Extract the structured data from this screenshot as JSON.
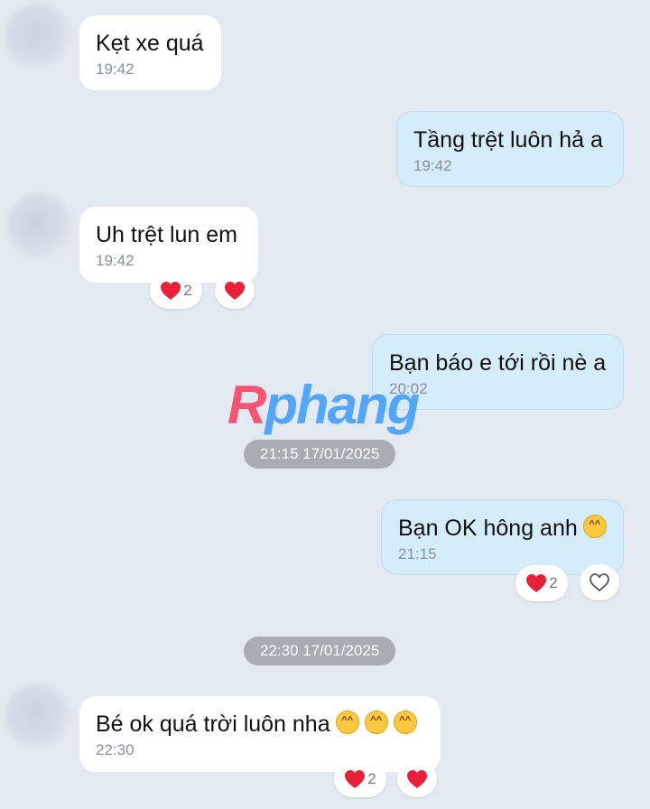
{
  "messages": [
    {
      "text": "Kẹt xe quá",
      "time": "19:42",
      "side": "in"
    },
    {
      "text": "Tầng trệt luôn hả a",
      "time": "19:42",
      "side": "out"
    },
    {
      "text": "Uh trệt lun em",
      "time": "19:42",
      "side": "in",
      "reaction_count": "2"
    },
    {
      "text": "Bạn báo e tới rồi nè a",
      "time": "20:02",
      "side": "out"
    },
    {
      "text": "Bạn OK hông anh",
      "time": "21:15",
      "side": "out",
      "reaction_count": "2"
    },
    {
      "text": "Bé ok quá trời luôn nha",
      "time": "22:30",
      "side": "in",
      "reaction_count": "2"
    }
  ],
  "date_separators": [
    "21:15 17/01/2025",
    "22:30 17/01/2025"
  ],
  "watermark": "Rphang",
  "colors": {
    "background": "#e2e9f1",
    "incoming_bubble": "#ffffff",
    "outgoing_bubble": "#d5edfb",
    "heart": "#e8203a",
    "separator_pill": "#a8adb3"
  },
  "icons": {
    "laugh_emoji": "grinning-squint-emoji",
    "heart_reaction": "red-heart-icon",
    "heart_outline": "heart-outline-icon"
  }
}
